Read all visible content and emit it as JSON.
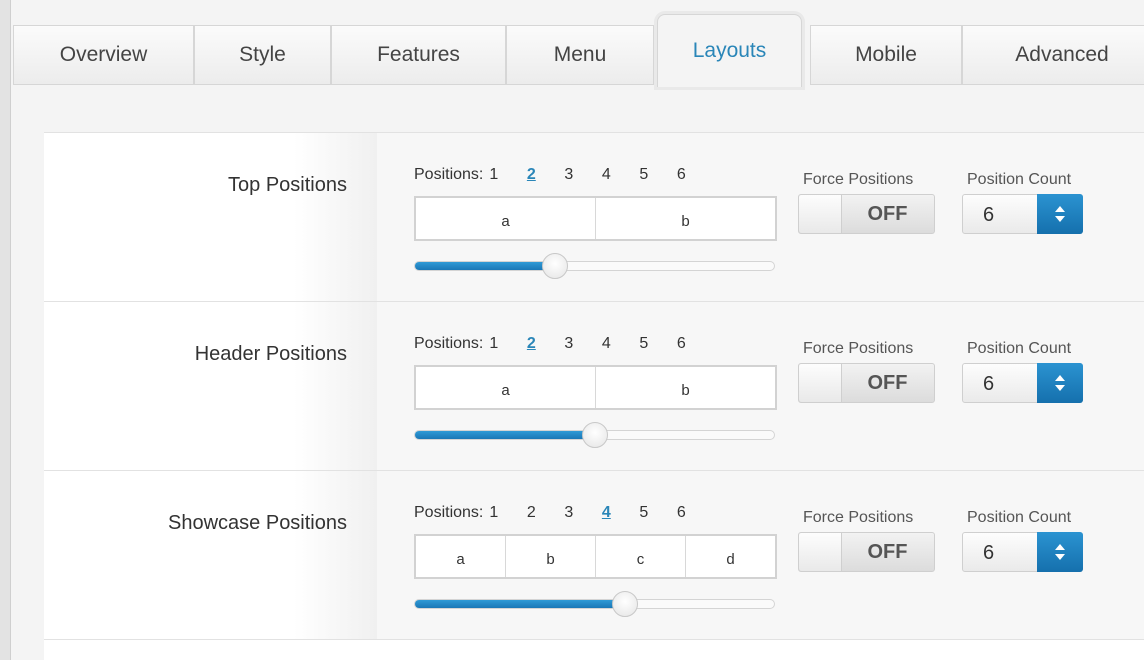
{
  "tabs": [
    {
      "label": "Overview"
    },
    {
      "label": "Style"
    },
    {
      "label": "Features"
    },
    {
      "label": "Menu"
    },
    {
      "label": "Layouts"
    },
    {
      "label": "Mobile"
    },
    {
      "label": "Advanced"
    }
  ],
  "active_tab": "Layouts",
  "positions_label": "Positions:",
  "position_numbers": [
    "1",
    "2",
    "3",
    "4",
    "5",
    "6"
  ],
  "force_label": "Force Positions",
  "count_label": "Position Count",
  "rows": [
    {
      "label": "Top Positions",
      "selected_positions": 2,
      "cells": [
        "a",
        "b"
      ],
      "slider_fraction": 0.39,
      "force": "OFF",
      "count": "6"
    },
    {
      "label": "Header Positions",
      "selected_positions": 2,
      "cells": [
        "a",
        "b"
      ],
      "slider_fraction": 0.5,
      "force": "OFF",
      "count": "6"
    },
    {
      "label": "Showcase Positions",
      "selected_positions": 4,
      "cells": [
        "a",
        "b",
        "c",
        "d"
      ],
      "slider_fraction": 0.585,
      "force": "OFF",
      "count": "6"
    }
  ],
  "colors": {
    "accent": "#2a86b8",
    "slider_fill": "#1f82c2",
    "stepper": "#1a78b8"
  }
}
